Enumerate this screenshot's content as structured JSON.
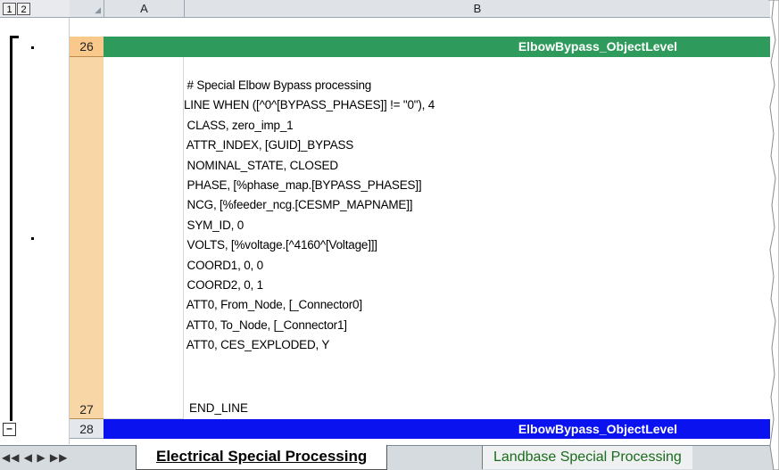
{
  "outline": {
    "levels": [
      "1",
      "2"
    ],
    "collapse_symbol": "–"
  },
  "columns": {
    "corner": "◢",
    "a": "A",
    "b": "B"
  },
  "rows": {
    "r26": {
      "num": "26",
      "title": "ElbowBypass_ObjectLevel"
    },
    "r27": {
      "num": "27"
    },
    "r28": {
      "num": "28",
      "title": "ElbowBypass_ObjectLevel"
    }
  },
  "code_lines": [
    " # Special Elbow Bypass processing",
    "LINE WHEN ([^0^[BYPASS_PHASES]] != \"0\"), 4",
    " CLASS, zero_imp_1",
    " ATTR_INDEX, [GUID]_BYPASS",
    " NOMINAL_STATE, CLOSED",
    " PHASE, [%phase_map.[BYPASS_PHASES]]",
    " NCG, [%feeder_ncg.[CESMP_MAPNAME]]",
    " SYM_ID, 0",
    " VOLTS, [%voltage.[^4160^[Voltage]]]",
    " COORD1, 0, 0",
    " COORD2, 0, 1",
    " ATT0, From_Node, [_Connector0]",
    " ATT0, To_Node, [_Connector1]",
    " ATT0, CES_EXPLODED, Y"
  ],
  "last_line": "END_LINE",
  "tabs": {
    "nav": "◀◀ ◀ ▶ ▶▶",
    "active": "Electrical Special Processing",
    "other": "Landbase Special Processing"
  },
  "colors": {
    "green_band": "#2e9b5c",
    "blue_band": "#0a12f0",
    "row_num_orange": "#f9c98b"
  }
}
